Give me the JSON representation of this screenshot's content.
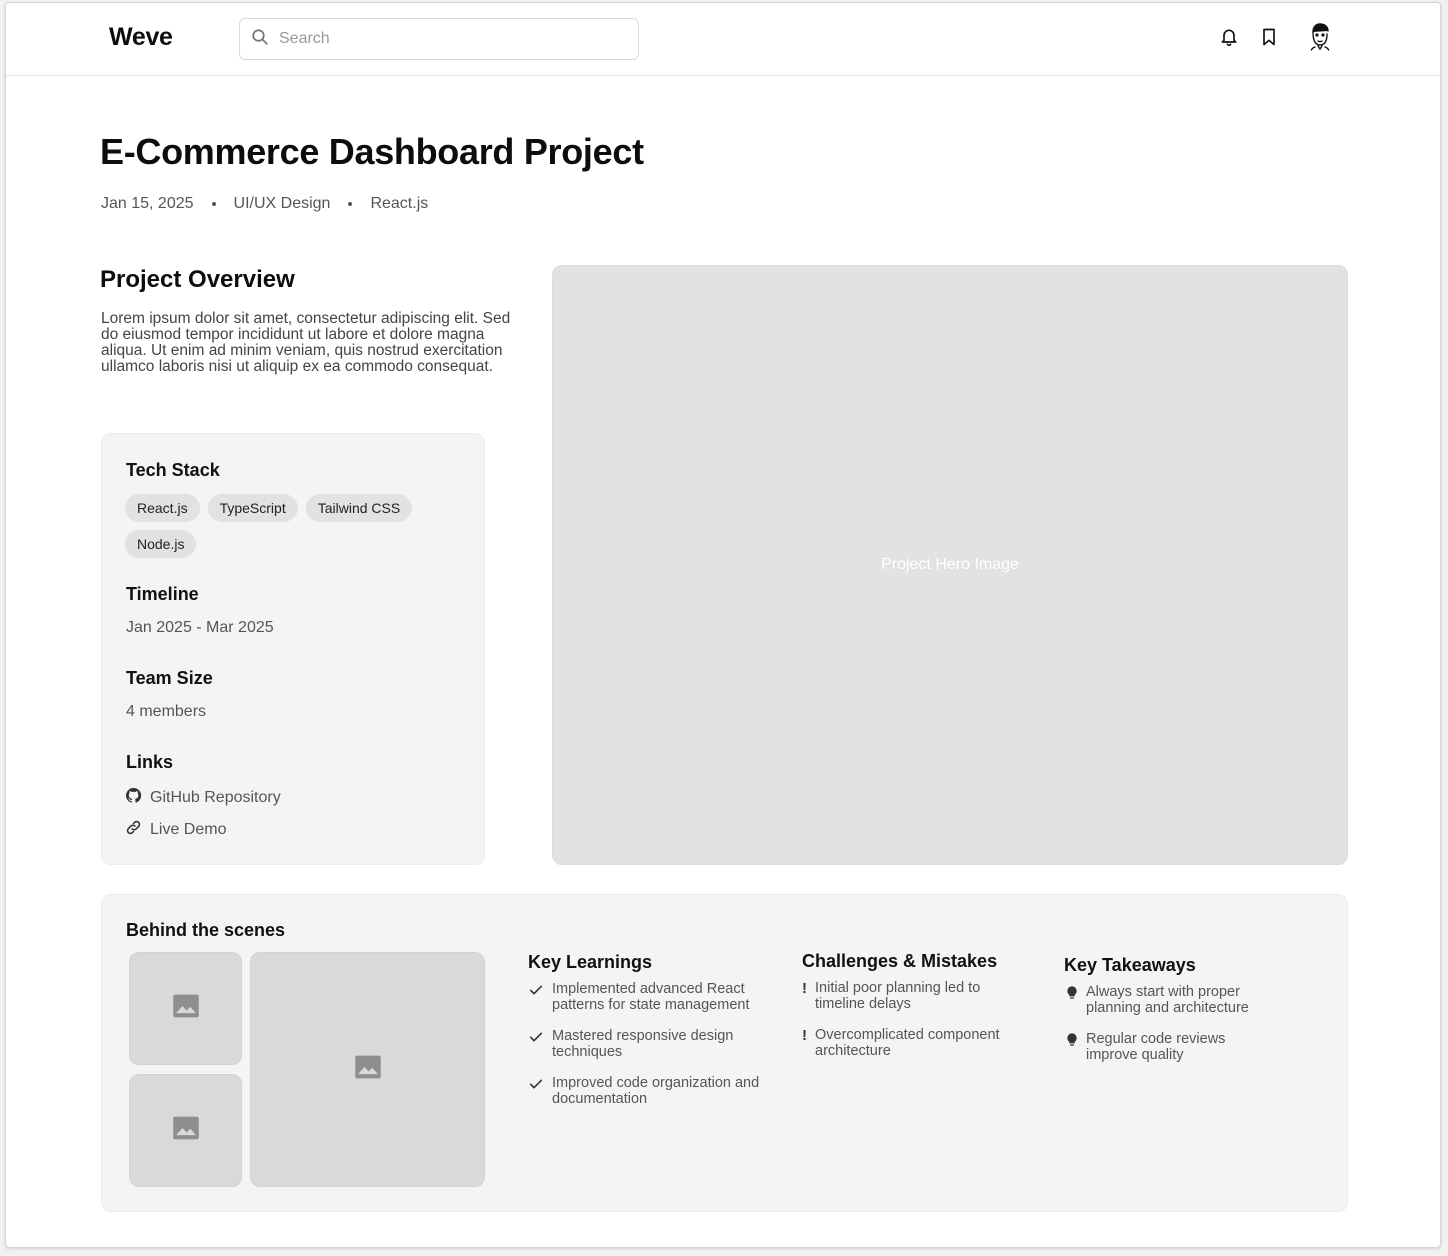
{
  "app": {
    "logo": "Weve"
  },
  "search": {
    "placeholder": "Search",
    "value": ""
  },
  "header": {
    "title": "E-Commerce Dashboard Project",
    "meta": [
      "Jan 15, 2025",
      "UI/UX Design",
      "React.js"
    ]
  },
  "overview": {
    "title": "Project Overview",
    "text": "Lorem ipsum dolor sit amet, consectetur adipiscing elit. Sed do eiusmod tempor incididunt ut labore et dolore magna aliqua. Ut enim ad minim veniam, quis nostrud exercitation ullamco laboris nisi ut aliquip ex ea commodo consequat."
  },
  "info": {
    "tech_stack_title": "Tech Stack",
    "tech_stack": [
      "React.js",
      "TypeScript",
      "Tailwind CSS",
      "Node.js"
    ],
    "timeline_title": "Timeline",
    "timeline": "Jan 2025 - Mar 2025",
    "team_size_title": "Team Size",
    "team_size": "4 members",
    "links_title": "Links",
    "links": [
      {
        "label": "GitHub Repository",
        "icon": "github-icon"
      },
      {
        "label": "Live Demo",
        "icon": "link-icon"
      }
    ]
  },
  "hero": {
    "label": "Project Hero Image"
  },
  "behind": {
    "title": "Behind the scenes",
    "learnings": {
      "title": "Key Learnings",
      "items": [
        "Implemented advanced React patterns for state management",
        "Mastered responsive design techniques",
        "Improved code organization and documentation"
      ]
    },
    "challenges": {
      "title": "Challenges & Mistakes",
      "items": [
        "Initial poor planning led to timeline delays",
        "Overcomplicated component architecture"
      ]
    },
    "takeaways": {
      "title": "Key Takeaways",
      "items": [
        "Always start with proper planning and architecture",
        "Regular code reviews improve quality"
      ]
    }
  },
  "colors": {
    "text": "#111111",
    "muted": "#555555",
    "card_bg": "#f4f4f4",
    "placeholder_bg": "#e2e2e2",
    "chip_bg": "#e2e2e2"
  }
}
